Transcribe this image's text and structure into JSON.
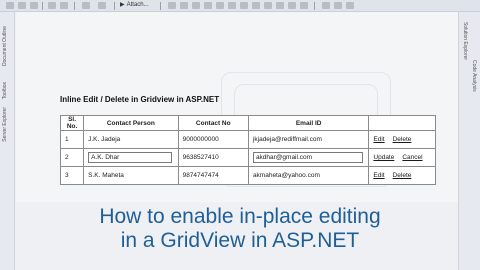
{
  "toolbar": {
    "attach_label": "Attach...",
    "play_glyph": "▶"
  },
  "left_panel_tabs": [
    "Document Outline",
    "Toolbox",
    "Server Explorer"
  ],
  "right_panel_tabs": [
    "Solution Explorer",
    "Code Analysis"
  ],
  "page": {
    "title": "Inline Edit / Delete in Gridview in ASP.NET"
  },
  "grid": {
    "headers": [
      "Sl. No.",
      "Contact Person",
      "Contact No",
      "Email ID",
      ""
    ],
    "rows": [
      {
        "sl": "1",
        "person": "J.K. Jadeja",
        "number": "9000000000",
        "email": "jkjadeja@rediffmail.com",
        "actions": [
          "Edit",
          "Delete"
        ]
      },
      {
        "sl": "2",
        "person": "A.K. Dhar",
        "number": "9638527410",
        "email": "akdhar@gmail.com",
        "actions": [
          "Update",
          "Cancel"
        ]
      },
      {
        "sl": "3",
        "person": "S.K. Maheta",
        "number": "9874747474",
        "email": "akmaheta@yahoo.com",
        "actions": [
          "Edit",
          "Delete"
        ]
      }
    ]
  },
  "caption": {
    "line1": "How to enable in-place editing",
    "line2": "in a GridView in ASP.NET"
  },
  "colors": {
    "caption": "#1f5f97",
    "toolbar": "#dfe3ea",
    "surface": "#f4f5f7"
  }
}
